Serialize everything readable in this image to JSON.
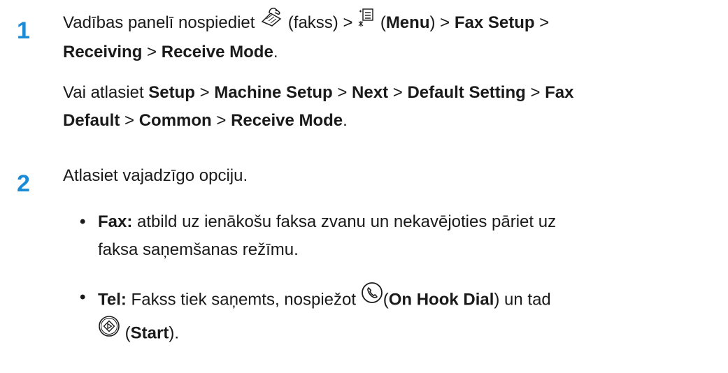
{
  "step1": {
    "number": "1",
    "line_a_prefix": "Vadības panelī nospiediet",
    "fax_label": "(fakss) >",
    "menu_open": "(",
    "menu_label": "Menu",
    "menu_close": ") >",
    "fax_setup": "Fax Setup",
    "sep1": " >",
    "receiving": "Receiving",
    "sep2": " > ",
    "receive_mode": "Receive Mode",
    "end": ".",
    "alt_prefix": "Vai atlasiet ",
    "setup": "Setup",
    "s1": " > ",
    "machine_setup": "Machine Setup",
    "s2": " > ",
    "next": "Next",
    "s3": " > ",
    "default_setting": "Default Setting",
    "s4": " > ",
    "fax": "Fax",
    "default_word": "Default",
    "s5": " > ",
    "common": "Common",
    "s6": " > ",
    "receive_mode2": "Receive Mode",
    "end2": "."
  },
  "step2": {
    "number": "2",
    "intro": "Atlasiet vajadzīgo opciju.",
    "bullet": "•",
    "fax_term": "Fax:",
    "fax_desc_1": " atbild uz ienākošu faksa zvanu un nekavējoties pāriet uz",
    "fax_desc_2": "faksa saņemšanas režīmu.",
    "tel_term": "Tel:",
    "tel_desc": " Fakss tiek saņemts, nospiežot ",
    "on_hook_open": "(",
    "on_hook_label": "On Hook Dial",
    "on_hook_close": ") un tad",
    "start_open": " (",
    "start_label": "Start",
    "start_close": ")."
  },
  "icons": [
    "fax-icon",
    "menu-icon",
    "on-hook-dial-icon",
    "start-icon"
  ],
  "colors": {
    "step_number": "#1b8bd6",
    "text": "#1a1a1a"
  }
}
